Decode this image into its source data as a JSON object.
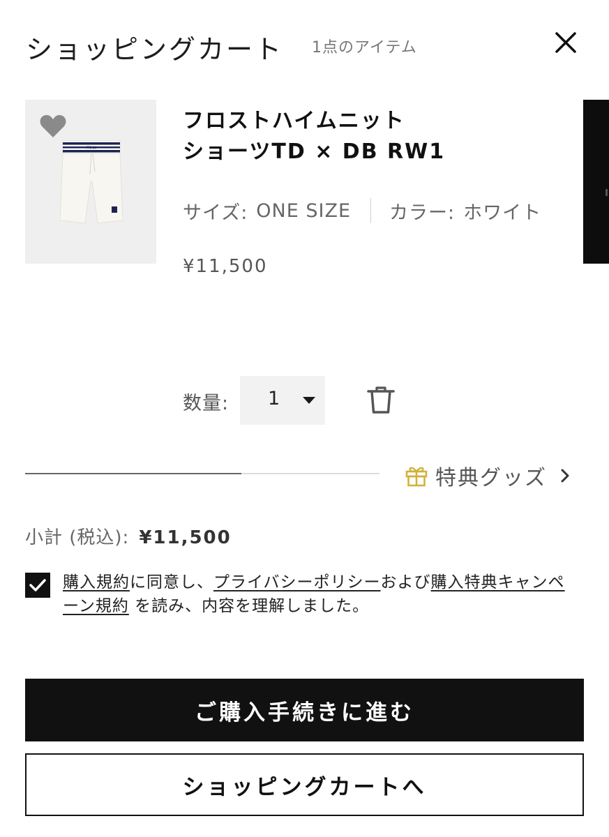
{
  "header": {
    "title": "ショッピングカート",
    "item_count": "1点のアイテム"
  },
  "product": {
    "name": "フロストハイムニット\nショーツTD × DB RW1",
    "size_label": "サイズ:",
    "size_value": "ONE SIZE",
    "color_label": "カラー:",
    "color_value": "ホワイト",
    "price": "¥11,500",
    "image_print": "FRHM"
  },
  "quantity": {
    "label": "数量:",
    "value": "1"
  },
  "bonus": {
    "label": "特典グッズ",
    "progress_fraction": 0.61
  },
  "subtotal": {
    "label": "小計 (税込):",
    "value": "¥11,500"
  },
  "agreement": {
    "checked": true,
    "link_terms": "購入規約",
    "text_1": "に同意し、",
    "link_privacy": "プライバシーポリシー",
    "text_2": "および",
    "link_campaign": "購入特典キャンペーン規約",
    "text_3": " を読み、内容を理解しました。"
  },
  "buttons": {
    "checkout": "ご購入手続きに進む",
    "view_cart": "ショッピングカートへ"
  },
  "colors": {
    "accent_gold": "#d2b13c",
    "primary_black": "#111111",
    "thumb_bg": "#efefef"
  },
  "icons": {
    "close": "close-icon",
    "favorite": "heart-icon",
    "delete": "trash-icon",
    "gift": "gift-icon",
    "chevron": "chevron-right-icon"
  }
}
